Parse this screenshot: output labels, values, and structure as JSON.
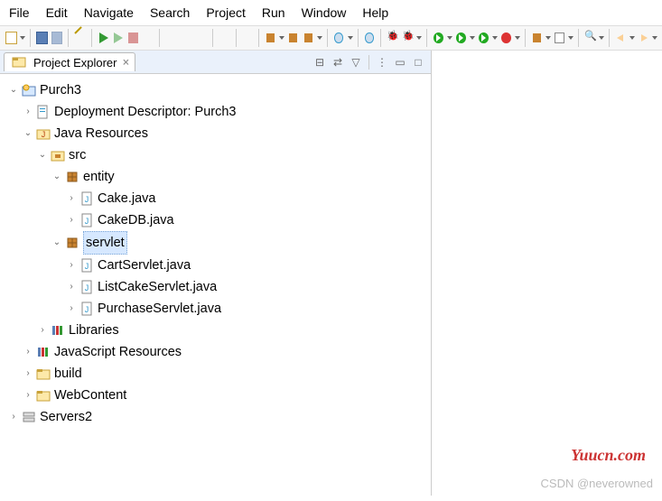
{
  "menu": [
    "File",
    "Edit",
    "Navigate",
    "Search",
    "Project",
    "Run",
    "Window",
    "Help"
  ],
  "view": {
    "title": "Project Explorer",
    "close": "×"
  },
  "tree": {
    "root": "Purch3",
    "dd": "Deployment Descriptor: Purch3",
    "jres": "Java Resources",
    "src": "src",
    "pkg_entity": "entity",
    "pkg_servlet": "servlet",
    "entity_files": [
      "Cake.java",
      "CakeDB.java"
    ],
    "servlet_files": [
      "CartServlet.java",
      "ListCakeServlet.java",
      "PurchaseServlet.java"
    ],
    "libraries": "Libraries",
    "jsres": "JavaScript Resources",
    "build": "build",
    "webcontent": "WebContent",
    "servers": "Servers2"
  },
  "watermark1": "Yuucn.com",
  "watermark2": "CSDN @neverowned"
}
